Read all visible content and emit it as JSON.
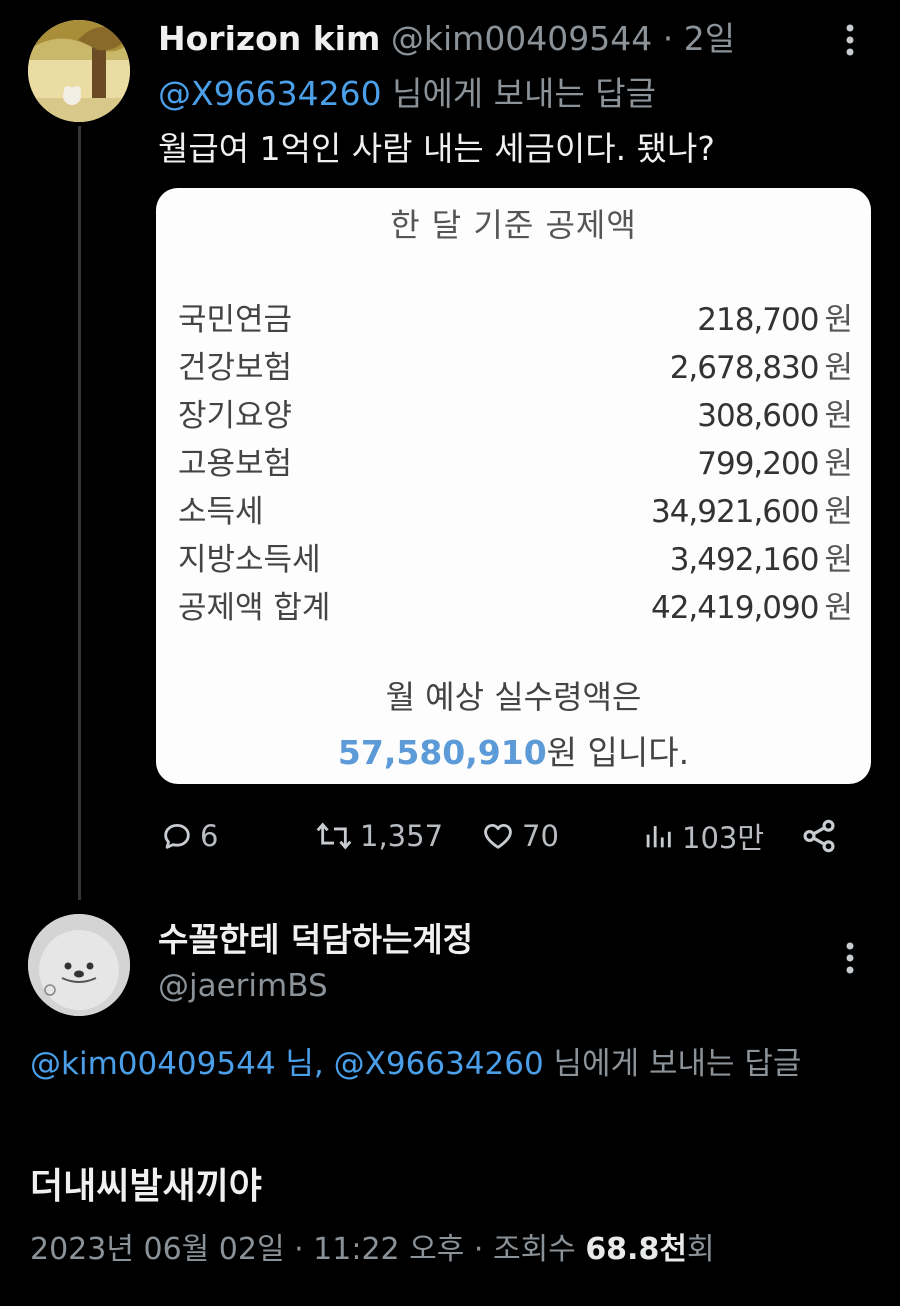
{
  "tweet1": {
    "display_name": "Horizon kim",
    "handle": "@kim00409544",
    "separator": "·",
    "time": "2일",
    "reply_to_handle": "@X96634260",
    "reply_to_suffix": "님에게 보내는 답글",
    "text": "월급여 1억인 사람 내는 세금이다. 됐나?",
    "card": {
      "title": "한 달 기준 공제액",
      "currency": "원",
      "items": [
        {
          "label": "국민연금",
          "value": "218,700"
        },
        {
          "label": "건강보험",
          "value": "2,678,830"
        },
        {
          "label": "장기요양",
          "value": "308,600"
        },
        {
          "label": "고용보험",
          "value": "799,200"
        },
        {
          "label": "소득세",
          "value": "34,921,600"
        },
        {
          "label": "지방소득세",
          "value": "3,492,160"
        },
        {
          "label": "공제액 합계",
          "value": "42,419,090"
        }
      ],
      "footer_line1": "월 예상 실수령액은",
      "footer_amount": "57,580,910",
      "footer_suffix": "원 입니다."
    },
    "actions": {
      "replies": "6",
      "retweets": "1,357",
      "likes": "70",
      "views": "103만"
    },
    "icons": [
      "more-icon",
      "reply-icon",
      "retweet-icon",
      "like-icon",
      "views-icon",
      "share-icon"
    ]
  },
  "tweet2": {
    "display_name": "수꼴한테 덕담하는계정",
    "handle": "@jaerimBS",
    "reply_mention1": "@kim00409544",
    "reply_mid": " 님, ",
    "reply_mention2": "@X96634260",
    "reply_suffix": " 님에게 보내는 답글",
    "text": "더내씨발새끼야",
    "date": "2023년 06월 02일 · 11:22 오후 · 조회수 ",
    "views_count": "68.8천",
    "views_suffix": "회"
  },
  "colors": {
    "background": "#000000",
    "link": "#4a9fe8",
    "muted": "#8b9298",
    "card_bg": "#fdfdfd",
    "amount": "#5d9ad8"
  }
}
